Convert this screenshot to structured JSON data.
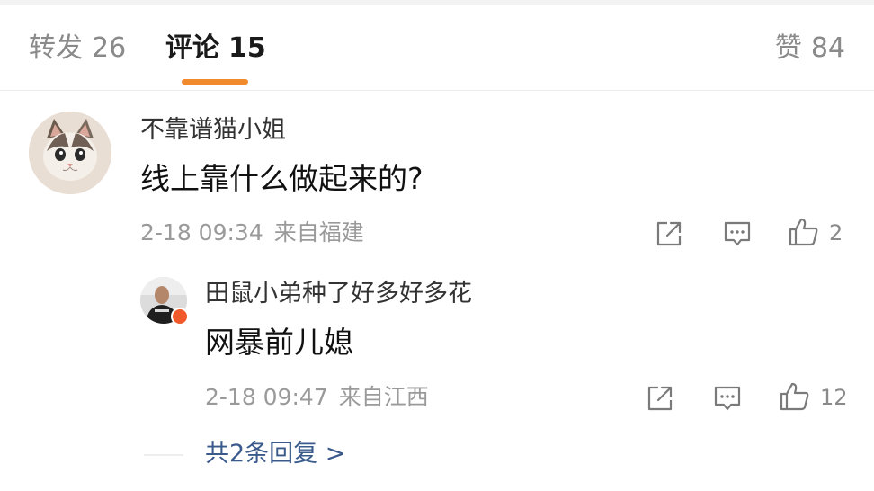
{
  "tabs": {
    "forward": {
      "label": "转发",
      "count": "26"
    },
    "comments": {
      "label": "评论",
      "count": "15"
    },
    "likes": {
      "label": "赞",
      "count": "84"
    }
  },
  "comment": {
    "username": "不靠谱猫小姐",
    "content": "线上靠什么做起来的?",
    "time": "2-18 09:34",
    "location": "来自福建",
    "like_count": "2",
    "avatar": "cat-avatar"
  },
  "reply": {
    "username": "田鼠小弟种了好多好多花",
    "content": "网暴前儿媳",
    "time": "2-18 09:47",
    "location": "来自江西",
    "like_count": "12",
    "avatar": "person-avatar"
  },
  "view_replies": "共2条回复 >",
  "icons": {
    "share": "share-icon",
    "comment": "comment-icon",
    "like": "thumbs-up-icon"
  },
  "colors": {
    "tab_underline": "#f08a2c",
    "link": "#3a5a8c",
    "badge": "#f05a2a"
  }
}
